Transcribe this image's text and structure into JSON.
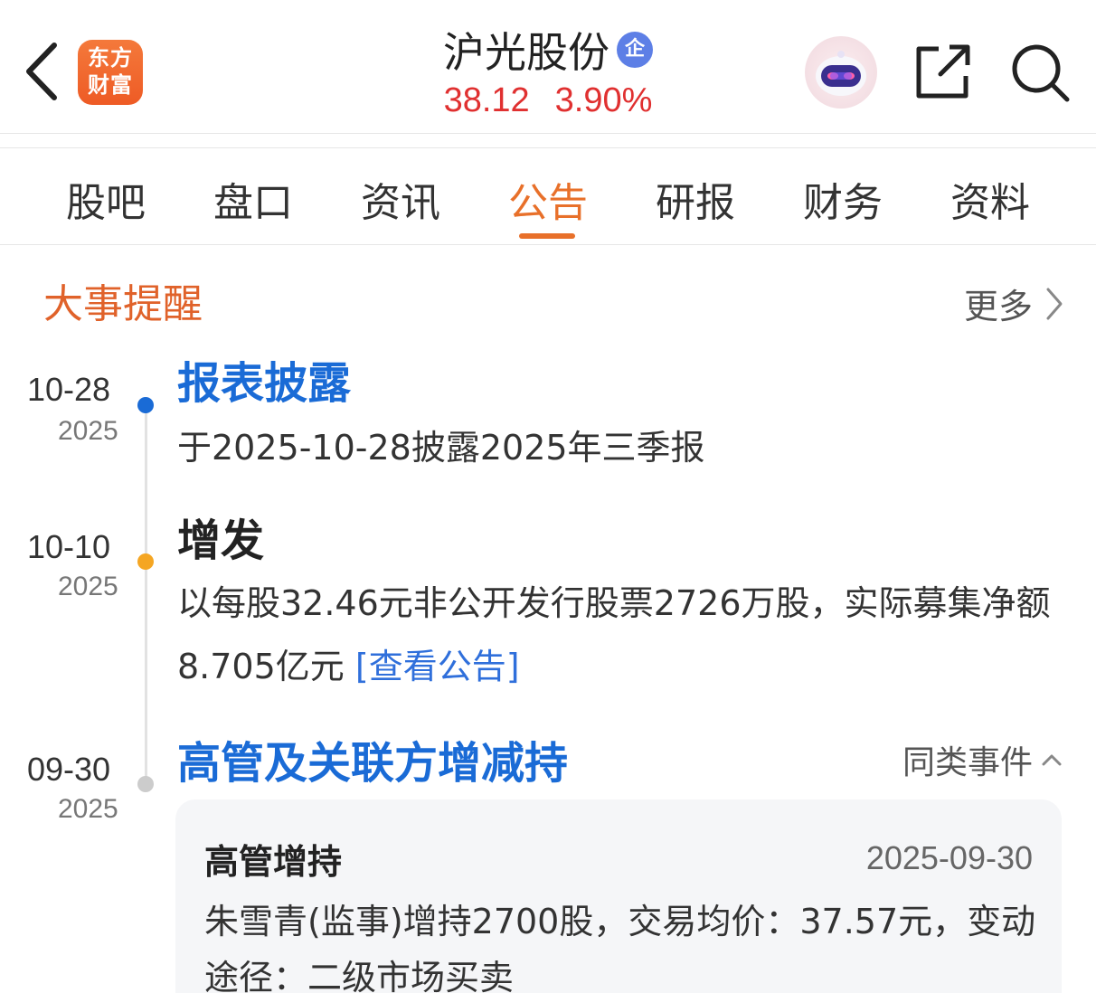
{
  "header": {
    "brand_logo_line1": "东方",
    "brand_logo_line2": "财富",
    "stock_name": "沪光股份",
    "enterprise_badge": "企",
    "price": "38.12",
    "change_pct": "3.90%",
    "price_color": "#e03030"
  },
  "tabs": [
    {
      "label": "股吧"
    },
    {
      "label": "盘口"
    },
    {
      "label": "资讯"
    },
    {
      "label": "公告",
      "active": true
    },
    {
      "label": "研报"
    },
    {
      "label": "财务"
    },
    {
      "label": "资料"
    }
  ],
  "section": {
    "title": "大事提醒",
    "more_label": "更多"
  },
  "events": [
    {
      "date_md": "10-28",
      "date_year": "2025",
      "dot_color": "#1a6bd6",
      "title": "报表披露",
      "description": "于2025-10-28披露2025年三季报"
    },
    {
      "date_md": "10-10",
      "date_year": "2025",
      "dot_color": "#f5a623",
      "title": "增发",
      "description": "以每股32.46元非公开发行股票2726万股，实际募集净额8.705亿元",
      "link_label": "[查看公告]"
    },
    {
      "date_md": "09-30",
      "date_year": "2025",
      "dot_color": "#cccccc",
      "title": "高管及关联方增减持",
      "similar_label": "同类事件",
      "card": {
        "title": "高管增持",
        "date": "2025-09-30",
        "description": "朱雪青(监事)增持2700股，交易均价：37.57元，变动途径：二级市场买卖"
      }
    }
  ],
  "accent_color": "#e8702a"
}
